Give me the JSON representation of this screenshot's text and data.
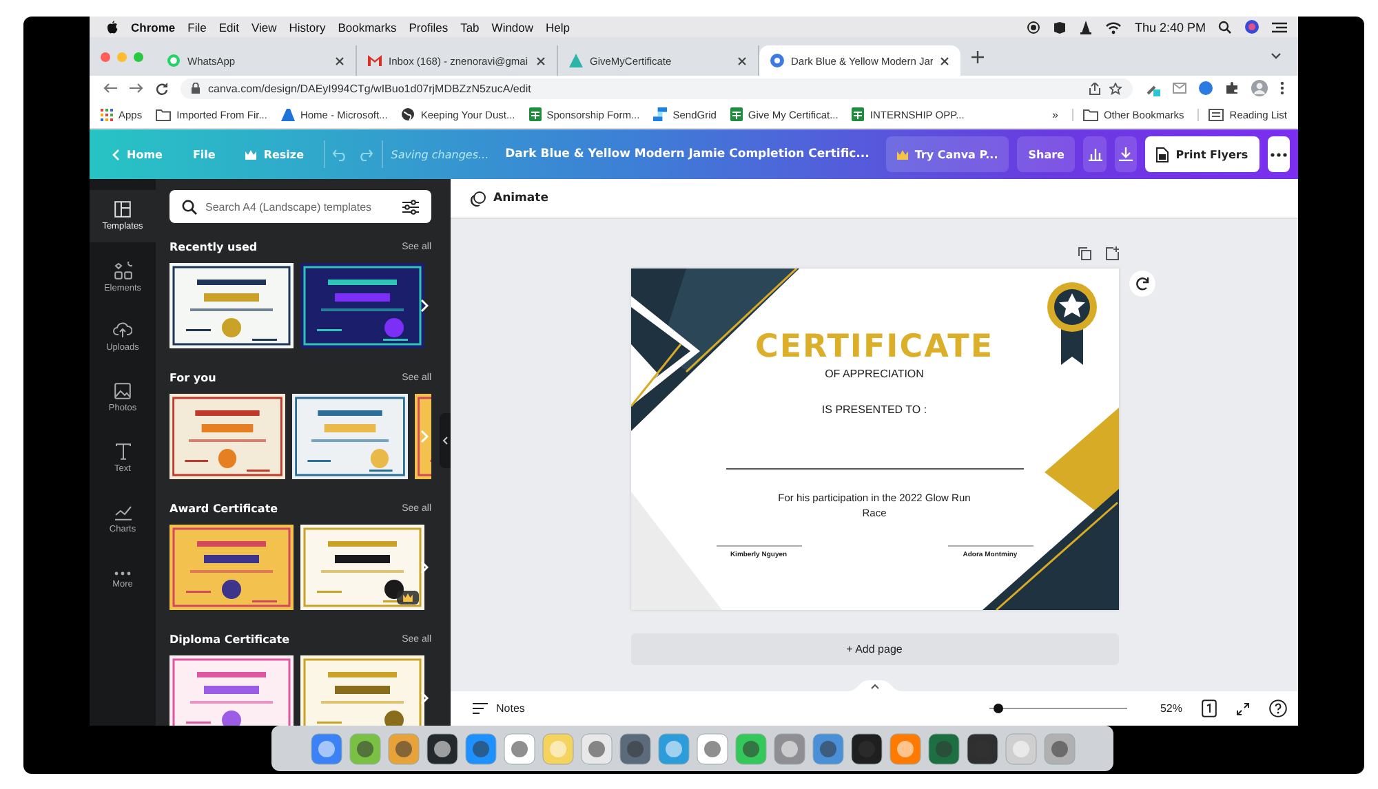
{
  "menubar": {
    "app": "Chrome",
    "items": [
      "File",
      "Edit",
      "View",
      "History",
      "Bookmarks",
      "Profiles",
      "Tab",
      "Window",
      "Help"
    ],
    "clock": "Thu 2:40 PM"
  },
  "tabs": [
    {
      "title": "WhatsApp",
      "kind": "chat",
      "selected": false
    },
    {
      "title": "Inbox (168) - znenoravi@gmai",
      "kind": "mail",
      "selected": false
    },
    {
      "title": "GiveMyCertificate",
      "kind": "cert",
      "selected": false
    },
    {
      "title": "Dark Blue & Yellow Modern Jar",
      "kind": "canva",
      "selected": true
    }
  ],
  "address": "canva.com/design/DAEyI994CTg/wIBuo1d07rjMDBZzN5zucA/edit",
  "bookmarks": [
    {
      "label": "Apps",
      "kind": "apps"
    },
    {
      "label": "Imported From Fir...",
      "kind": "folder"
    },
    {
      "label": "Home - Microsoft...",
      "kind": "azure"
    },
    {
      "label": "Keeping Your Dust...",
      "kind": "globe"
    },
    {
      "label": "Sponsorship Form...",
      "kind": "sheet"
    },
    {
      "label": "SendGrid",
      "kind": "grid"
    },
    {
      "label": "Give My Certificat...",
      "kind": "sheet"
    },
    {
      "label": "INTERNSHIP OPP...",
      "kind": "sheet"
    }
  ],
  "bookmarks_more": "»",
  "bookmarks_right": [
    {
      "label": "Other Bookmarks",
      "kind": "folder"
    },
    {
      "label": "Reading List",
      "kind": "reading"
    }
  ],
  "toolbar": {
    "home": "Home",
    "file": "File",
    "resize": "Resize",
    "status": "Saving changes...",
    "title": "Dark Blue & Yellow Modern Jamie Completion Certific...",
    "pro": "Try Canva P...",
    "share": "Share",
    "print": "Print Flyers"
  },
  "rail": [
    {
      "label": "Templates",
      "kind": "templates",
      "selected": true
    },
    {
      "label": "Elements",
      "kind": "elements",
      "selected": false
    },
    {
      "label": "Uploads",
      "kind": "uploads",
      "selected": false
    },
    {
      "label": "Photos",
      "kind": "photos",
      "selected": false
    },
    {
      "label": "Text",
      "kind": "text",
      "selected": false
    },
    {
      "label": "Charts",
      "kind": "charts",
      "selected": false
    },
    {
      "label": "More",
      "kind": "more",
      "selected": false
    }
  ],
  "panel": {
    "search_placeholder": "Search A4 (Landscape) templates",
    "sections": [
      {
        "title": "Recently used",
        "see_all": "See all",
        "thumbnails": [
          {
            "premium": false
          },
          {
            "premium": false
          }
        ]
      },
      {
        "title": "For you",
        "see_all": "See all",
        "thumbnails": [
          {
            "premium": false
          },
          {
            "premium": false
          },
          {
            "premium": false
          }
        ]
      },
      {
        "title": "Award Certificate",
        "see_all": "See all",
        "thumbnails": [
          {
            "premium": false
          },
          {
            "premium": true
          }
        ]
      },
      {
        "title": "Diploma Certificate",
        "see_all": "See all",
        "thumbnails": [
          {
            "premium": false
          },
          {
            "premium": false
          }
        ]
      }
    ]
  },
  "animate": "Animate",
  "certificate": {
    "title": "CERTIFICATE",
    "subtitle": "OF APPRECIATION",
    "presented": "IS PRESENTED TO :",
    "reason": "For his participation in the 2022 Glow Run Race",
    "signatures": [
      "Kimberly Nguyen",
      "Adora Montminy"
    ]
  },
  "add_page": "+ Add page",
  "footer": {
    "notes": "Notes",
    "zoom": {
      "level": 0.06,
      "reading": "52%"
    }
  }
}
